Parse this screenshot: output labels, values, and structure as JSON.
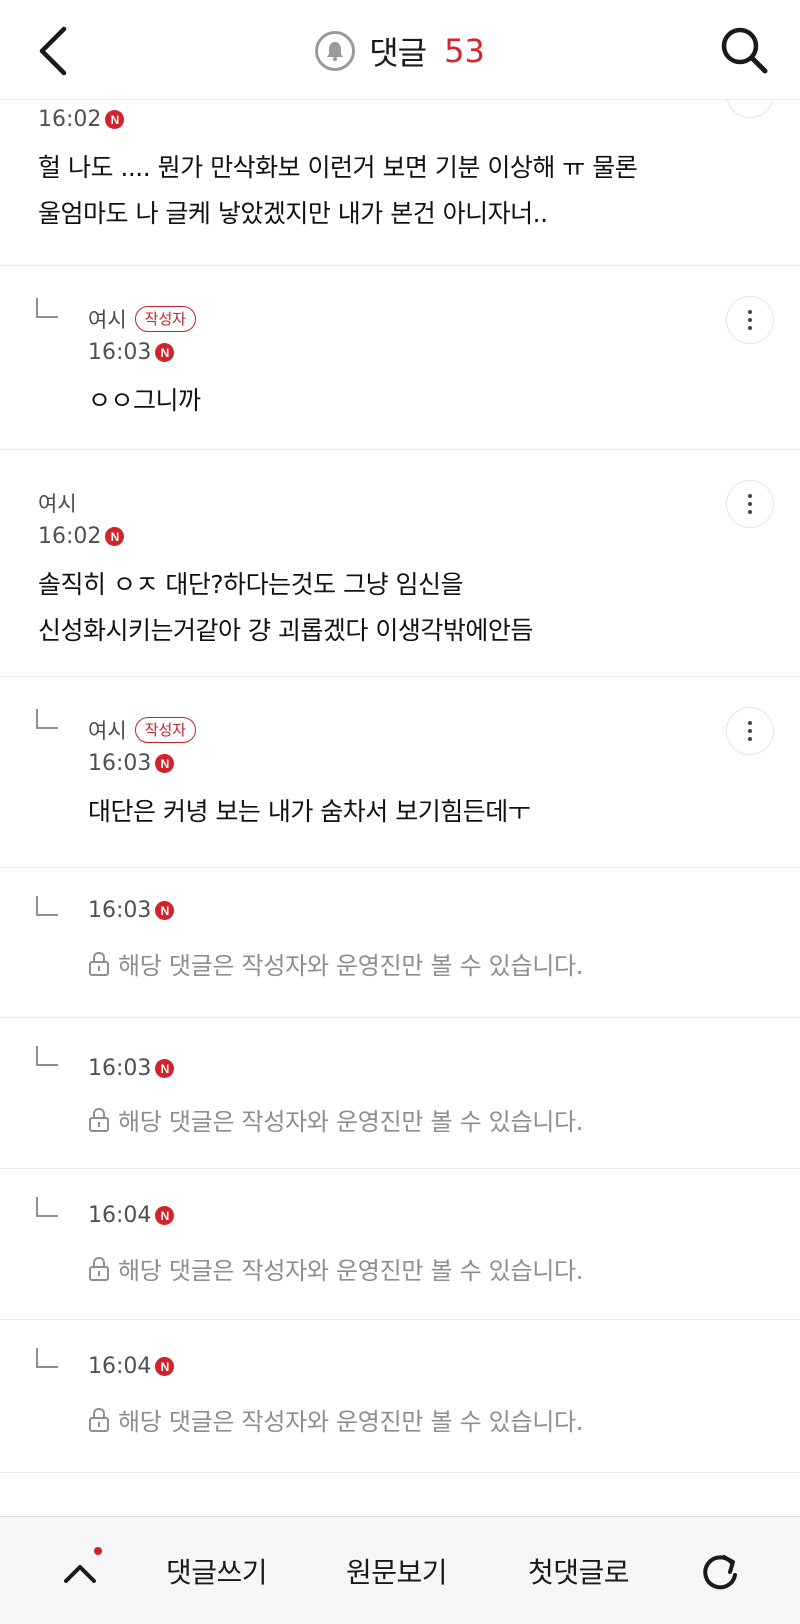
{
  "header": {
    "back_icon": "chevron-left-icon",
    "notify_icon": "bell-icon",
    "title": "댓글",
    "count": "53",
    "search_icon": "search-icon"
  },
  "new_badge_letter": "N",
  "comments": [
    {
      "kind": "stub",
      "time": "16:02",
      "text_lines": [
        "헐 나도 .... 뭔가 만삭화보 이런거 보면 기분 이상해 ㅠ 물론",
        "울엄마도 나 글케 낳았겠지만 내가 본건 아니자너.."
      ]
    },
    {
      "kind": "reply",
      "author": "여시",
      "op_badge": "작성자",
      "time": "16:03",
      "text_lines": [
        "ㅇㅇ그니까"
      ]
    },
    {
      "kind": "comment",
      "author": "여시",
      "time": "16:02",
      "text_lines": [
        "솔직히 ㅇㅈ 대단?하다는것도 그냥 임신을",
        "신성화시키는거같아 걍 괴롭겠다 이생각밖에안듬"
      ]
    },
    {
      "kind": "reply",
      "author": "여시",
      "op_badge": "작성자",
      "time": "16:03",
      "text_lines": [
        "대단은 커녕 보는 내가 숨차서 보기힘든데ㅜ"
      ]
    },
    {
      "kind": "private",
      "time": "16:03",
      "text": "해당 댓글은 작성자와 운영진만 볼 수 있습니다."
    },
    {
      "kind": "private",
      "time": "16:03",
      "text": "해당 댓글은 작성자와 운영진만 볼 수 있습니다."
    },
    {
      "kind": "private",
      "time": "16:04",
      "text": "해당 댓글은 작성자와 운영진만 볼 수 있습니다."
    },
    {
      "kind": "private",
      "time": "16:04",
      "text": "해당 댓글은 작성자와 운영진만 볼 수 있습니다."
    }
  ],
  "bottom_bar": {
    "scroll_top_icon": "chevron-up-icon",
    "write_label": "댓글쓰기",
    "original_label": "원문보기",
    "first_label": "첫댓글로",
    "refresh_icon": "refresh-icon"
  },
  "colors": {
    "accent": "#d6262d",
    "muted_text": "#8e8e8e",
    "divider": "#ececec"
  }
}
